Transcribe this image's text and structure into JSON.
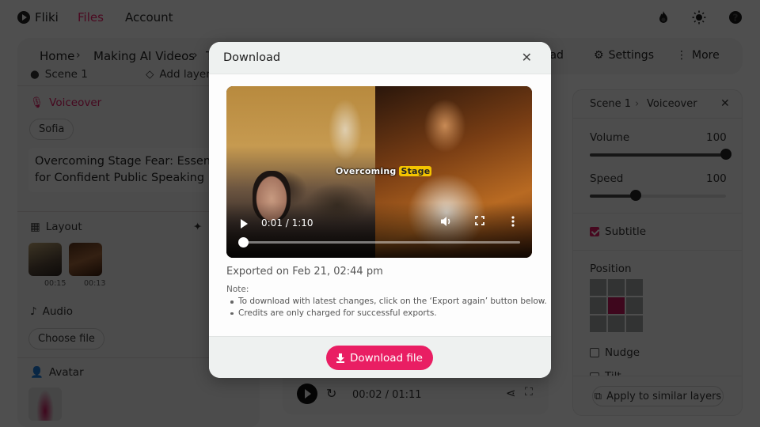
{
  "app": {
    "brand": "Fliki",
    "nav": [
      {
        "label": "Files",
        "active": true
      },
      {
        "label": "Account",
        "active": false
      }
    ],
    "top_icons": [
      "fire-icon",
      "theme-sun-icon",
      "help-icon"
    ]
  },
  "toolbar": {
    "breadcrumb": [
      "Home",
      "Making AI Videos",
      "T"
    ],
    "download_partial": "load",
    "settings_label": "Settings",
    "more_label": "More"
  },
  "left_panel": {
    "scene_label": "Scene 1",
    "add_layer_label": "Add layer",
    "voiceover": {
      "title": "Voiceover",
      "voice": "Sofia",
      "script": "Overcoming Stage Fear: Essential for Confident Public Speaking",
      "script_line1": "Overcoming Stage Fear: Essential",
      "script_line2": "for Confident Public Speaking"
    },
    "layout": {
      "title": "Layout",
      "thumbs": [
        {
          "duration": "00:15"
        },
        {
          "duration": "00:13"
        }
      ]
    },
    "audio": {
      "title": "Audio",
      "choose_file_label": "Choose file"
    },
    "avatar": {
      "title": "Avatar"
    }
  },
  "center_player": {
    "time": "00:02 / 01:11"
  },
  "right_panel": {
    "breadcrumb": [
      "Scene 1",
      "Voiceover"
    ],
    "volume": {
      "label": "Volume",
      "value": "100",
      "fraction": 1.0
    },
    "speed": {
      "label": "Speed",
      "value": "100",
      "fraction": 0.34
    },
    "subtitle": {
      "label": "Subtitle",
      "checked": true
    },
    "position": {
      "label": "Position",
      "selected_index": 4
    },
    "nudge": {
      "label": "Nudge",
      "checked": false
    },
    "tilt": {
      "label": "Tilt",
      "checked": false
    },
    "apply_label": "Apply to similar layers"
  },
  "modal": {
    "title": "Download",
    "video": {
      "caption_plain": "Overcoming",
      "caption_highlight": "Stage",
      "time": "0:01 / 1:10",
      "progress_fraction": 0.014
    },
    "exported_text": "Exported on Feb 21, 02:44 pm",
    "note_title": "Note:",
    "notes": [
      "To download with latest changes, click on the ‘Export again’ button below.",
      "Credits are only charged for successful exports."
    ],
    "download_button": "Download file"
  },
  "colors": {
    "accent": "#e91e63",
    "caption_highlight": "#f4c400"
  }
}
